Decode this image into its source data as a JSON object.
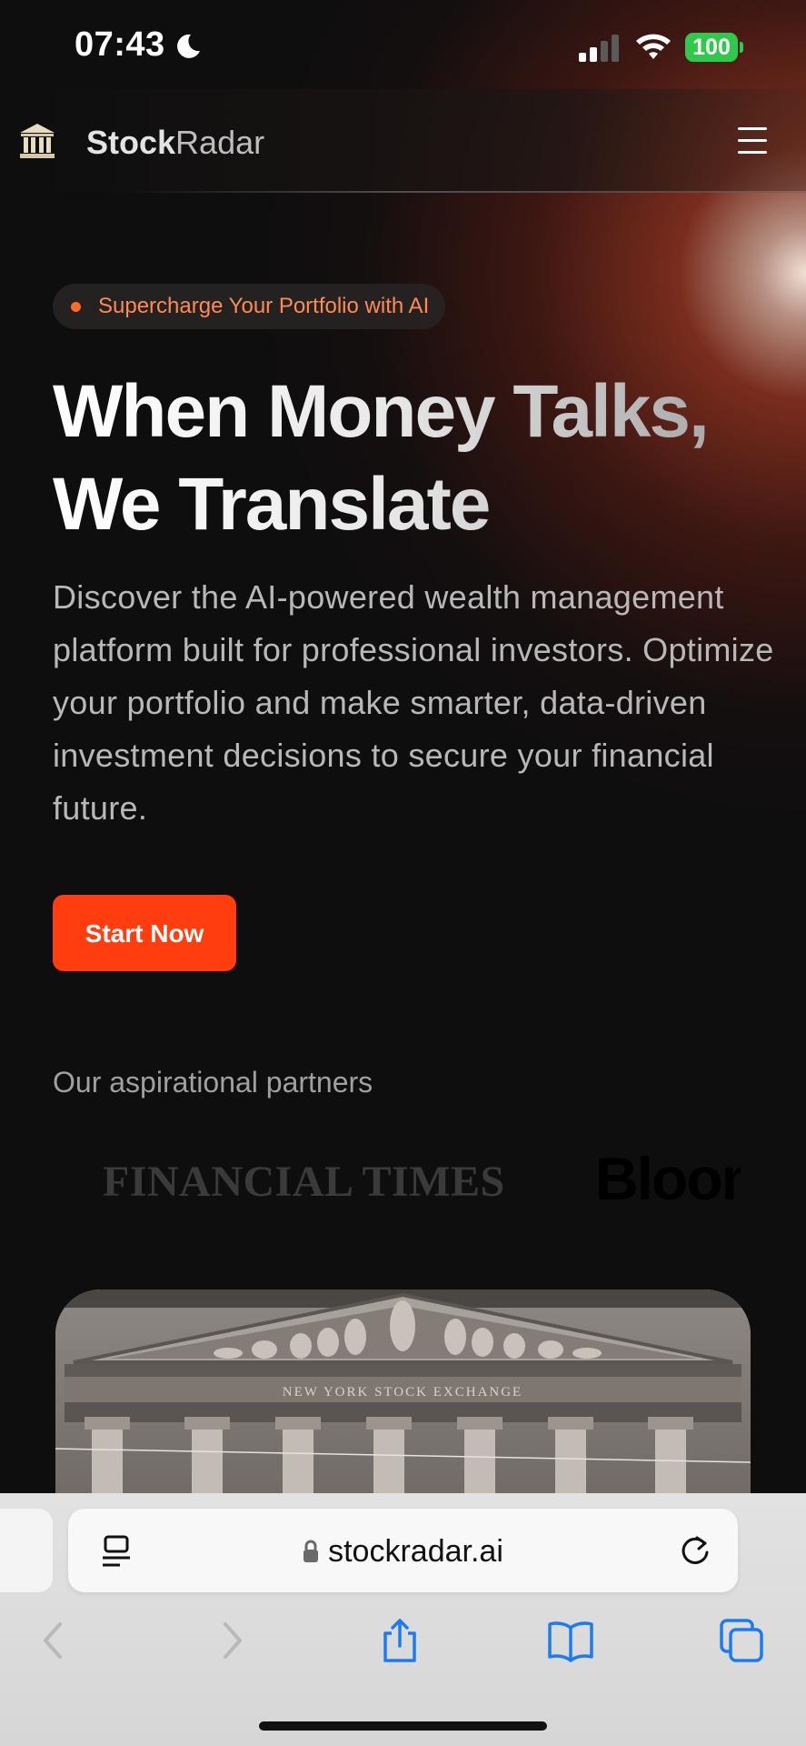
{
  "status_bar": {
    "time": "07:43",
    "battery": "100"
  },
  "nav": {
    "brand_main": "Stock",
    "brand_accent": "Radar"
  },
  "hero": {
    "badge": "Supercharge Your Portfolio with AI",
    "headline_line1": "When Money Talks,",
    "headline_line2": "We Translate",
    "description": "Discover the AI-powered wealth management platform built for professional investors. Optimize your portfolio and make smarter, data-driven investment decisions to secure your financial future.",
    "cta": "Start Now"
  },
  "partners": {
    "label": "Our aspirational partners",
    "logos": [
      "FINANCIAL TIMES",
      "Bloomberg"
    ]
  },
  "photo": {
    "engraving": "NEW YORK STOCK EXCHANGE"
  },
  "browser": {
    "url": "stockradar.ai"
  },
  "colors": {
    "accent": "#ff3d0f",
    "badge_text": "#ff8a55",
    "battery": "#31c94b",
    "safari_blue": "#1a7cf0"
  }
}
